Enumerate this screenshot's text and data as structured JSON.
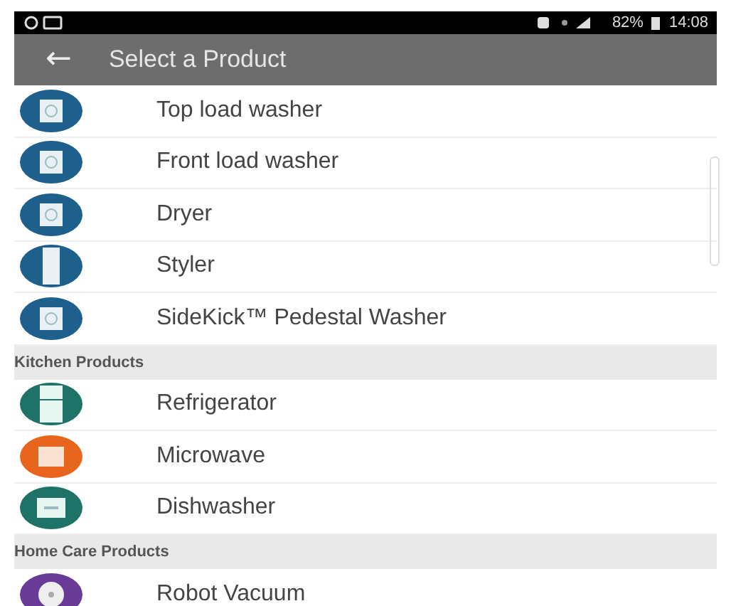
{
  "status_bar": {
    "battery": "82%",
    "time": "14:08"
  },
  "app_bar": {
    "back": "←",
    "title": "Select a Product"
  },
  "sections": [
    {
      "items": [
        {
          "name": "Top load washer",
          "kind": "washer",
          "color": "#1f5f8b"
        },
        {
          "name": "Front load washer",
          "kind": "washer",
          "color": "#1f5f8b"
        },
        {
          "name": "Dryer",
          "kind": "washer",
          "color": "#1f5f8b"
        },
        {
          "name": "Styler",
          "kind": "styler",
          "color": "#1f5f8b"
        },
        {
          "name": "SideKick™ Pedestal Washer",
          "kind": "washer",
          "color": "#1f5f8b"
        }
      ]
    },
    {
      "header": "Kitchen Products",
      "items": [
        {
          "name": "Refrigerator",
          "kind": "fridge",
          "color": "#1e7268"
        },
        {
          "name": "Microwave",
          "kind": "microwave",
          "color": "#e8651e"
        },
        {
          "name": "Dishwasher",
          "kind": "dishwasher",
          "color": "#1e7268"
        }
      ]
    },
    {
      "header": "Home Care Products",
      "items": [
        {
          "name": "Robot Vacuum",
          "kind": "vacuum",
          "color": "#6a3a97"
        }
      ]
    }
  ]
}
